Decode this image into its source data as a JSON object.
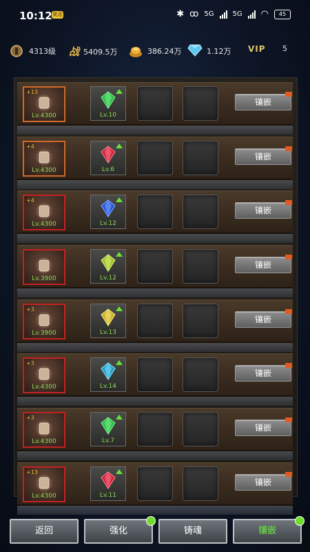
{
  "status_bar": {
    "time": "10:12",
    "badge": "笑话",
    "net1": "5G",
    "net2": "5G",
    "battery": "45"
  },
  "resources": {
    "level": "4313级",
    "battle_icon_text": "战",
    "battle_power": "5409.5万",
    "gold": "386.24万",
    "diamonds": "1.12万",
    "vip_label": "VIP",
    "vip_level": "5"
  },
  "colors": {
    "equip_orange": "#d06a2a",
    "equip_red": "#c42222",
    "level_green": "#8bdc5a",
    "active_tab": "#6cf13b"
  },
  "rows": [
    {
      "equip_plus": "+13",
      "equip_level": "Lv.4300",
      "equip_icon": "axe-icon",
      "gem_level": "Lv.10",
      "gem_icon": "green-gem-icon",
      "button": "镶嵌"
    },
    {
      "equip_plus": "+4",
      "equip_level": "Lv.4300",
      "equip_icon": "chest-armor-icon",
      "gem_level": "Lv.6",
      "gem_icon": "red-gem-icon",
      "button": "镶嵌"
    },
    {
      "equip_plus": "+4",
      "equip_level": "Lv.4300",
      "equip_icon": "armor-icon",
      "gem_level": "Lv.12",
      "gem_icon": "blue-gem-icon",
      "button": "镶嵌"
    },
    {
      "equip_plus": "",
      "equip_level": "Lv.3900",
      "equip_icon": "boots-icon",
      "gem_level": "Lv.12",
      "gem_icon": "yellow-crystal-icon",
      "button": "镶嵌"
    },
    {
      "equip_plus": "+3",
      "equip_level": "Lv.3900",
      "equip_icon": "gauntlet-icon",
      "gem_level": "Lv.13",
      "gem_icon": "yellow-gem-icon",
      "button": "镶嵌"
    },
    {
      "equip_plus": "+3",
      "equip_level": "Lv.4300",
      "equip_icon": "belt-icon",
      "gem_level": "Lv.14",
      "gem_icon": "teal-gem-icon",
      "button": "镶嵌"
    },
    {
      "equip_plus": "+3",
      "equip_level": "Lv.4300",
      "equip_icon": "amulet-icon",
      "gem_level": "Lv.7",
      "gem_icon": "green-gem-icon",
      "button": "镶嵌"
    },
    {
      "equip_plus": "+13",
      "equip_level": "Lv.4300",
      "equip_icon": "ring-icon",
      "gem_level": "Lv.11",
      "gem_icon": "red-gem-icon",
      "button": "镶嵌"
    }
  ],
  "tabs": [
    {
      "label": "返回"
    },
    {
      "label": "强化"
    },
    {
      "label": "铸魂"
    },
    {
      "label": "镶嵌"
    }
  ]
}
